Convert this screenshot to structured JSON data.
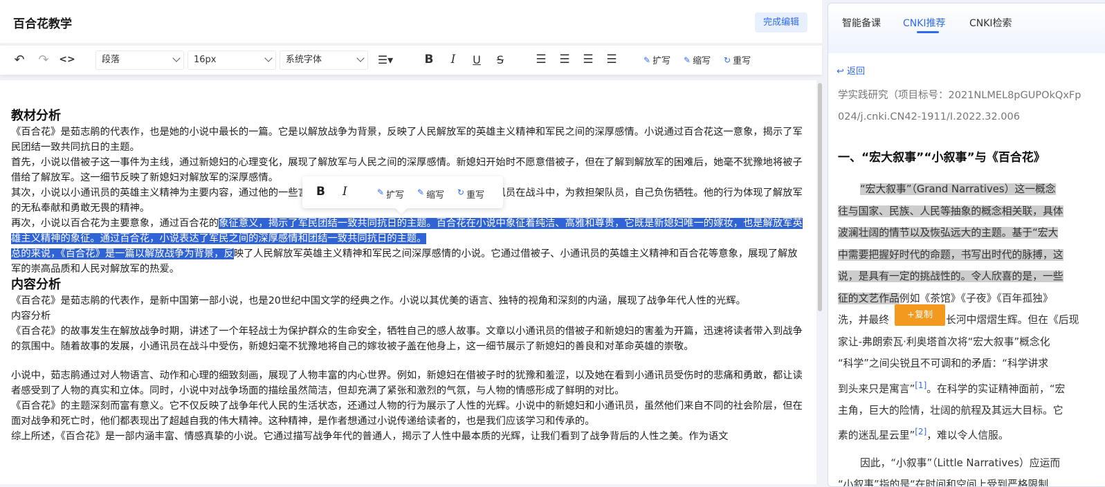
{
  "doc": {
    "title": "百合花教学",
    "finish_label": "完成编辑"
  },
  "toolbar": {
    "paragraph": "段落",
    "font_size": "16px",
    "font_family": "系统字体",
    "expand": "扩写",
    "shrink": "缩写",
    "rewrite": "重写"
  },
  "content": {
    "h1": "教材分析",
    "p1": "《百合花》是茹志鹃的代表作，也是她的小说中最长的一篇。它是以解放战争为背景，反映了人民解放军的英雄主义精神和军民之间的深厚感情。小说通过百合花这一意象，揭示了军民团结一致共同抗日的主题。",
    "p2": "首先，小说以借被子这一事件为主线，通过新媳妇的心理变化，展现了解放军与人民之间的深厚感情。新媳妇开始时不愿意借被子，但在了解到解放军的困难后，她毫不犹豫地将被子借给了解放军。这一细节反映了新媳妇对解放军的深厚感情。",
    "p3": "其次，小说以小通讯员的英雄主义精神为主要内容，通过他的一些言行，展现了解放军的英勇无畏的精神。小通讯员在战斗中，为救担架队员，自己负伤牺牲。他的行为体现了解放军的无私奉献和勇敢无畏的精神。",
    "p4a": "再次，小说以百合花为主要意象，通过百合花的",
    "p4b": "象征意义，揭示了军民团结一致共同抗日的主题。百合花在小说中象征着纯洁、高雅和尊贵，它既是新媳妇唯一的嫁妆，也是解放军英雄主义精神的象征。通过百合花，小说表达了军民之间的深厚感情和团结一致共同抗日的主题。",
    "p5a": "总的来说，《百合花》是一篇以解放战争为背景，反",
    "p5b": "映了人民解放军英雄主义精神和军民之间深厚感情的小说。它通过借被子、小通讯员的英雄主义精神和百合花等意象，展现了解放军的崇高品质和人民对解放军的热爱。",
    "h2": "内容分析",
    "p6": "《百合花》是茹志鹃的代表作，是新中国第一部小说，也是20世纪中国文学的经典之作。小说以其优美的语言、独特的视角和深刻的内涵，展现了战争年代人性的光辉。",
    "p7": "内容分析",
    "p8": "《百合花》的故事发生在解放战争时期，讲述了一个年轻战士为保护群众的生命安全，牺牲自己的感人故事。文章以小通讯员的借被子和新媳妇的害羞为开篇，迅速将读者带入到战争的氛围中。随着故事的发展，小通讯员在战斗中受伤，新媳妇毫不犹豫地将自己的嫁妆被子盖在他身上，这一细节展示了新媳妇的善良和对革命英雄的崇敬。",
    "p9": "小说中，茹志鹃通过对人物语言、动作和心理的细致刻画，展现了人物丰富的内心世界。例如，新媳妇在借被子时的犹豫和羞涩，以及她在看到小通讯员受伤时的悲痛和勇敢，都让读者感受到了人物的真实和立体。同时，小说中对战争场面的描绘虽然简洁，但却充满了紧张和激烈的气氛，与人物的情感形成了鲜明的对比。",
    "p10": "《百合花》的主题深刻而富有意义。它不仅反映了战争年代人民的生活状态，还通过人物的行为展示了人性的光辉。小说中的新媳妇和小通讯员，虽然他们来自不同的社会阶层，但在面对战争和死亡时，他们都表现出了超越自我的伟大精神。这种精神，是作者想通过小说传递给读者的，也是我们应该学习和传承的。",
    "p11": "综上所述，《百合花》是一部内涵丰富、情感真挚的小说。它通过描写战争年代的普通人，揭示了人性中最本质的光辉，让我们看到了战争背后的人性之美。作为语文"
  },
  "floatbar": {
    "bold": "B",
    "italic": "I",
    "expand": "扩写",
    "shrink": "缩写",
    "rewrite": "重写"
  },
  "panel": {
    "tabs": [
      "智能备课",
      "CNKI推荐",
      "CNKI检索"
    ],
    "back": "返回",
    "meta1": "学实践研究（项目标号：2021NLMEL8pGUPOkQxFp",
    "meta2": "024/j.cnki.CN42-1911/I.2022.32.006",
    "heading": "一、“宏大叙事”“小叙事”与《百合花》",
    "lines": [
      "“宏大叙事”（Grand Narratives）这一概念",
      "往与国家、民族、人民等抽象的概念相关联，具体",
      "波澜壮阔的情节以及恢弘远大的主题。基于“宏大",
      "中需要把握好时代的命题，书写出时代的脉搏，这",
      "说，是具有一定的挑战性的。令人欣喜的是，一些",
      "征的文艺作品",
      "例如《茶馆》《子夜》《百年孤独》",
      "洗，并最终",
      "长河中熠熠生辉。但在《后现",
      "家让-弗朗索瓦·利奥塔首次将“宏大叙事”概念化",
      "“科学”之间尖锐且不可调和的矛盾：“科学讲求",
      "到头来只是寓言”",
      "。在科学的实证精神面前，“宏",
      "主角，巨大的险情，壮阔的航程及其远大目标。它",
      "素的迷乱星云里”",
      "，难以令人信服。",
      "因此，“小叙事”（Little Narratives）应运而",
      "“小叙事”指的是“在时间和空间上受到严格限制"
    ],
    "ref1": "[1]",
    "ref2": "[2]",
    "copy_label": "+复制"
  }
}
